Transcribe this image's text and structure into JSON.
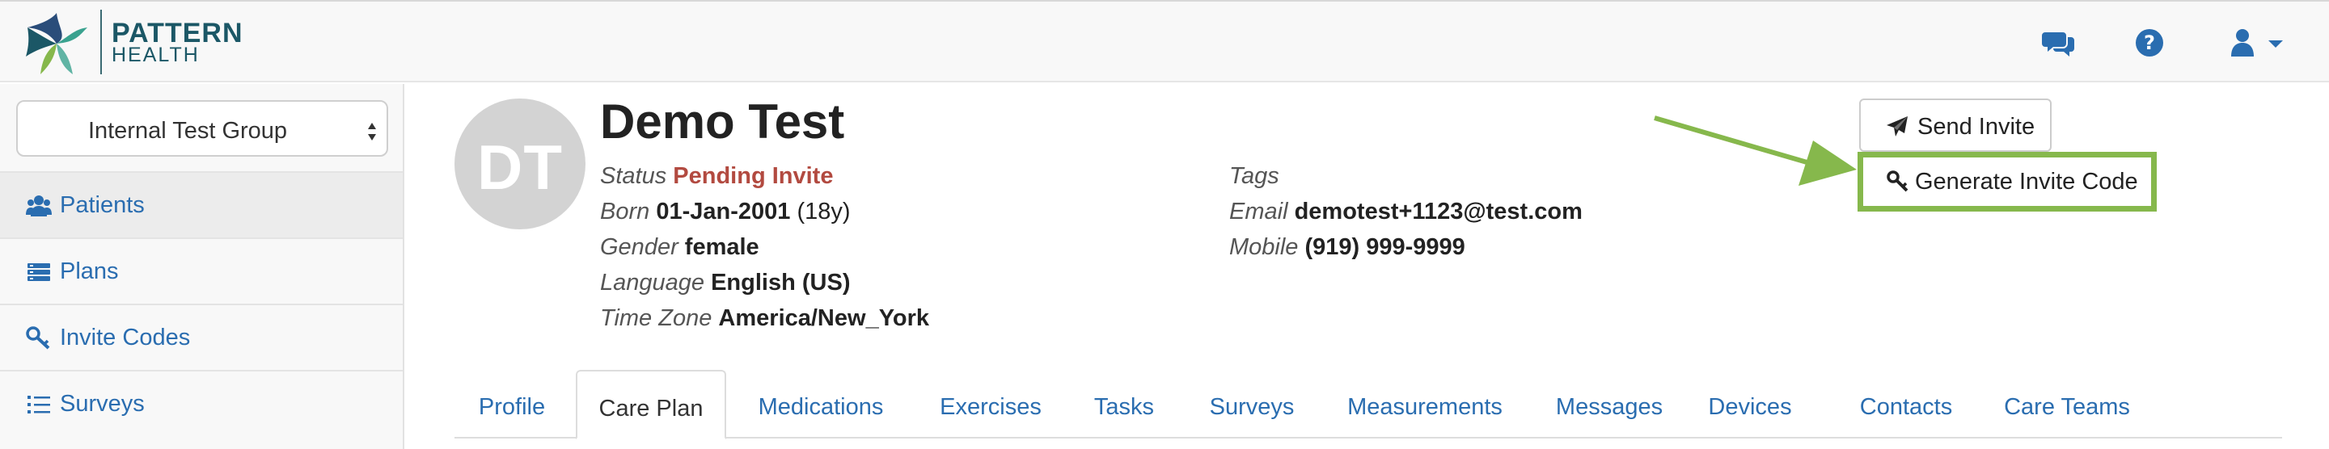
{
  "brand": {
    "line1": "PATTERN",
    "line2": "HEALTH",
    "colors": [
      "#1b5766",
      "#3aa28f",
      "#86b84c",
      "#2a4d7a"
    ]
  },
  "navbar": {
    "icons": [
      "chat-icon",
      "help-icon",
      "user-icon"
    ]
  },
  "sidebar": {
    "group_select": {
      "value": "Internal Test Group"
    },
    "items": [
      {
        "label": "Patients",
        "icon": "users-icon",
        "active": true
      },
      {
        "label": "Plans",
        "icon": "plans-icon",
        "active": false
      },
      {
        "label": "Invite Codes",
        "icon": "key-icon",
        "active": false
      },
      {
        "label": "Surveys",
        "icon": "list-icon",
        "active": false
      }
    ]
  },
  "patient": {
    "initials": "DT",
    "name": "Demo Test",
    "status_label": "Status",
    "status_value": "Pending Invite",
    "born_label": "Born",
    "born_value": "01-Jan-2001",
    "age": "(18y)",
    "gender_label": "Gender",
    "gender_value": "female",
    "language_label": "Language",
    "language_value": "English (US)",
    "timezone_label": "Time Zone",
    "timezone_value": "America/New_York",
    "tags_label": "Tags",
    "email_label": "Email",
    "email_value": "demotest+1123@test.com",
    "mobile_label": "Mobile",
    "mobile_value": "(919) 999-9999"
  },
  "actions": {
    "send_invite": "Send Invite",
    "generate_invite_code": "Generate Invite Code",
    "highlight_color": "#86b84c"
  },
  "tabs": [
    {
      "label": "Profile"
    },
    {
      "label": "Care Plan",
      "active": true
    },
    {
      "label": "Medications"
    },
    {
      "label": "Exercises"
    },
    {
      "label": "Tasks"
    },
    {
      "label": "Surveys"
    },
    {
      "label": "Measurements"
    },
    {
      "label": "Messages"
    },
    {
      "label": "Devices"
    },
    {
      "label": "Contacts"
    },
    {
      "label": "Care Teams"
    }
  ],
  "colors": {
    "link": "#2a6db0",
    "status_pending": "#b24a40",
    "avatar_bg": "#d3d3d3"
  }
}
